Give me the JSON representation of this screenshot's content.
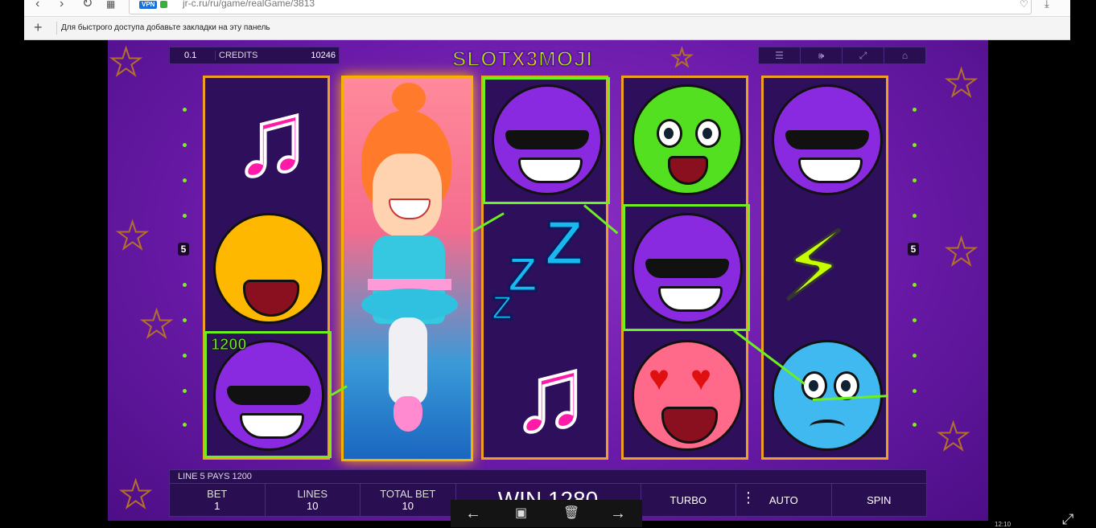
{
  "browser": {
    "url": "jr-c.ru/ru/game/realGame/3813",
    "vpn_badge": "VPN",
    "bookmarks_hint": "Для быстрого доступа добавьте закладки на эту панель"
  },
  "game": {
    "logo_left": "SLOT",
    "logo_x3": "X3",
    "logo_right": "MOJI",
    "bet_display": "0.1",
    "credits_label": "CREDITS",
    "credits_value": "10246",
    "line_pays": "LINE 5 PAYS 1200",
    "win_amount_badge": "1200",
    "line_marker_left": "5",
    "line_marker_right": "5",
    "controls": {
      "bet_label": "BET",
      "bet_value": "1",
      "lines_label": "LINES",
      "lines_value": "10",
      "total_bet_label": "TOTAL BET",
      "total_bet_value": "10",
      "win_text": "WIN 1280",
      "turbo_label": "TURBO",
      "auto_label": "AUTO",
      "spin_label": "SPIN"
    },
    "symbols": {
      "reel1": [
        "music-note",
        "laughing-tears",
        "sunglasses-purple"
      ],
      "reel2": [
        "ballerina-wild"
      ],
      "reel3": [
        "sunglasses-purple",
        "zzz-sleep",
        "music-note"
      ],
      "reel4": [
        "green-sick",
        "sunglasses-purple",
        "heart-eyes"
      ],
      "reel5": [
        "sunglasses-purple",
        "lightning-bolt",
        "blue-crying"
      ]
    },
    "colors": {
      "win_line": "#6cf020",
      "reel_border": "#f0a020",
      "background": "#6a1aa8"
    }
  },
  "overlay": {
    "time": "12:10"
  }
}
